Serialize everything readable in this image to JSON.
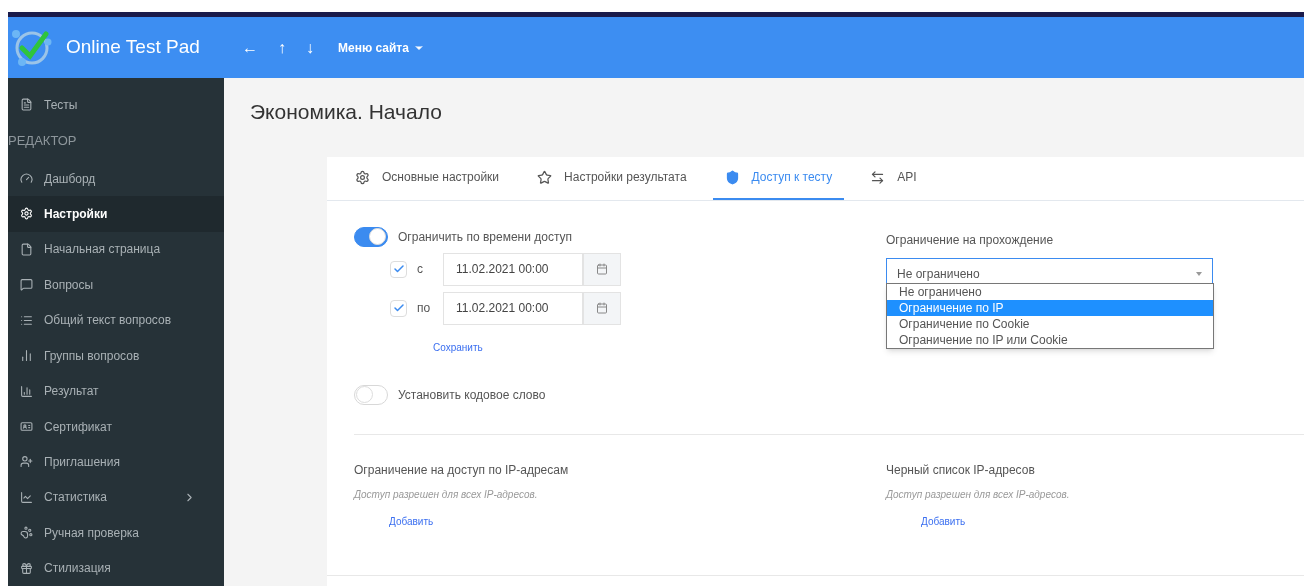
{
  "header": {
    "brand": "Online Test Pad",
    "nav": [
      "←",
      "↑",
      "↓"
    ],
    "menu": "Меню сайта"
  },
  "sidebar": {
    "top_item": {
      "label": "Тесты"
    },
    "section": "РЕДАКТОР",
    "items": [
      {
        "label": "Дашборд",
        "selected": false
      },
      {
        "label": "Настройки",
        "selected": true
      },
      {
        "label": "Начальная страница",
        "selected": false
      },
      {
        "label": "Вопросы",
        "selected": false
      },
      {
        "label": "Общий текст вопросов",
        "selected": false
      },
      {
        "label": "Группы вопросов",
        "selected": false
      },
      {
        "label": "Результат",
        "selected": false
      },
      {
        "label": "Сертификат",
        "selected": false
      },
      {
        "label": "Приглашения",
        "selected": false
      },
      {
        "label": "Статистика",
        "selected": false,
        "expandable": true
      },
      {
        "label": "Ручная проверка",
        "selected": false
      },
      {
        "label": "Стилизация",
        "selected": false
      }
    ]
  },
  "page_title": "Экономика. Начало",
  "tabs": [
    {
      "label": "Основные настройки",
      "selected": false
    },
    {
      "label": "Настройки результата",
      "selected": false
    },
    {
      "label": "Доступ к тесту",
      "selected": true
    },
    {
      "label": "API",
      "selected": false
    }
  ],
  "time_limit": {
    "label": "Ограничить по времени доступ",
    "on": true,
    "rows": [
      {
        "label": "с",
        "checked": true,
        "value": "11.02.2021 00:00"
      },
      {
        "label": "по",
        "checked": true,
        "value": "11.02.2021 00:00"
      }
    ],
    "save": "Сохранить"
  },
  "code_word": {
    "label": "Установить кодовое слово",
    "on": false
  },
  "pass_limit": {
    "label": "Ограничение на прохождение",
    "value": "Не ограничено",
    "expanded": true,
    "options": [
      {
        "label": "Не ограничено",
        "highlighted": false
      },
      {
        "label": "Ограничение по IP",
        "highlighted": true
      },
      {
        "label": "Ограничение по Cookie",
        "highlighted": false
      },
      {
        "label": "Ограничение по IP или Cookie",
        "highlighted": false
      }
    ]
  },
  "ip_sections": [
    {
      "title": "Ограничение на доступ по IP-адресам",
      "note": "Доступ разрешен для всех IP-адресов.",
      "add": "Добавить"
    },
    {
      "title": "Черный список IP-адресов",
      "note": "Доступ разрешен для всех IP-адресов.",
      "add": "Добавить"
    }
  ]
}
